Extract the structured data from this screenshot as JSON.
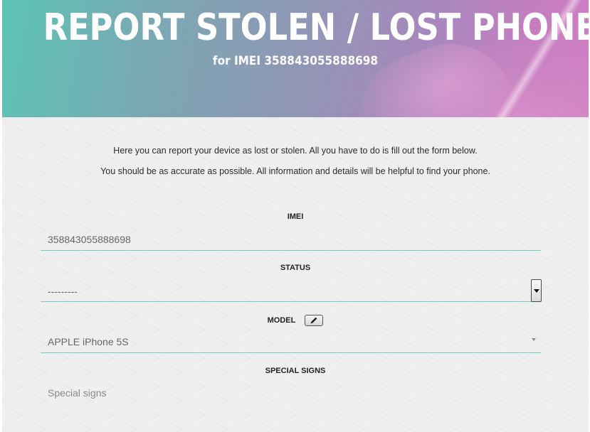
{
  "header": {
    "title": "REPORT STOLEN / LOST PHONE",
    "subtitle_prefix": "for IMEI",
    "subtitle_imei": "358843055888698"
  },
  "intro": {
    "line1": "Here you can report your device as lost or stolen. All you have to do is fill out the form below.",
    "line2": "You should be as accurate as possible. All information and details will be helpful to find your phone."
  },
  "form": {
    "imei": {
      "label": "IMEI",
      "value": "358843055888698"
    },
    "status": {
      "label": "STATUS",
      "selected": "---------"
    },
    "model": {
      "label": "MODEL",
      "edit_icon": "pencil-icon",
      "selected": "APPLE iPhone 5S"
    },
    "special_signs": {
      "label": "SPECIAL SIGNS",
      "placeholder": "Special signs"
    }
  },
  "colors": {
    "hero_teal": "#5cc4b3",
    "hero_pink": "#cf7fc3",
    "field_underline": "#6fcfbf",
    "content_bg": "#efefef"
  }
}
